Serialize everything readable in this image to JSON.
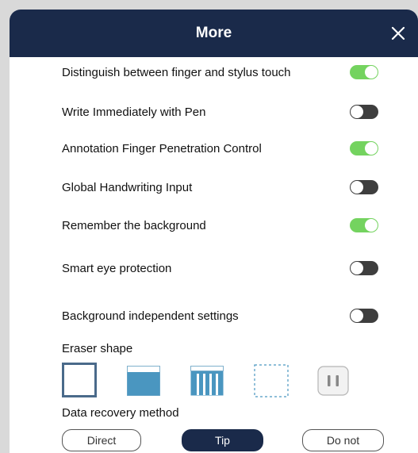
{
  "dialog": {
    "title": "More"
  },
  "settings": [
    {
      "label": "Distinguish between finger and stylus touch",
      "on": true
    },
    {
      "label": "Write Immediately with Pen",
      "on": false
    },
    {
      "label": "Annotation Finger Penetration Control",
      "on": true
    },
    {
      "label": "Global Handwriting Input",
      "on": false
    },
    {
      "label": "Remember the background",
      "on": true
    },
    {
      "label": "Smart eye protection",
      "on": false
    },
    {
      "label": "Background independent settings",
      "on": false
    }
  ],
  "eraser": {
    "label": "Eraser shape",
    "shapes": [
      "square-outline-icon",
      "rectangle-filled-icon",
      "stripes-icon",
      "dashed-square-icon",
      "pause-icon"
    ],
    "selected": "square-outline-icon"
  },
  "recovery": {
    "label": "Data recovery method",
    "options": [
      "Direct",
      "Tip",
      "Do not"
    ],
    "selected": "Tip"
  },
  "colors": {
    "header": "#1a2a4a",
    "toggle_on": "#74d35f",
    "toggle_off": "#3e3e3e",
    "shape_fill": "#4a96c0"
  }
}
